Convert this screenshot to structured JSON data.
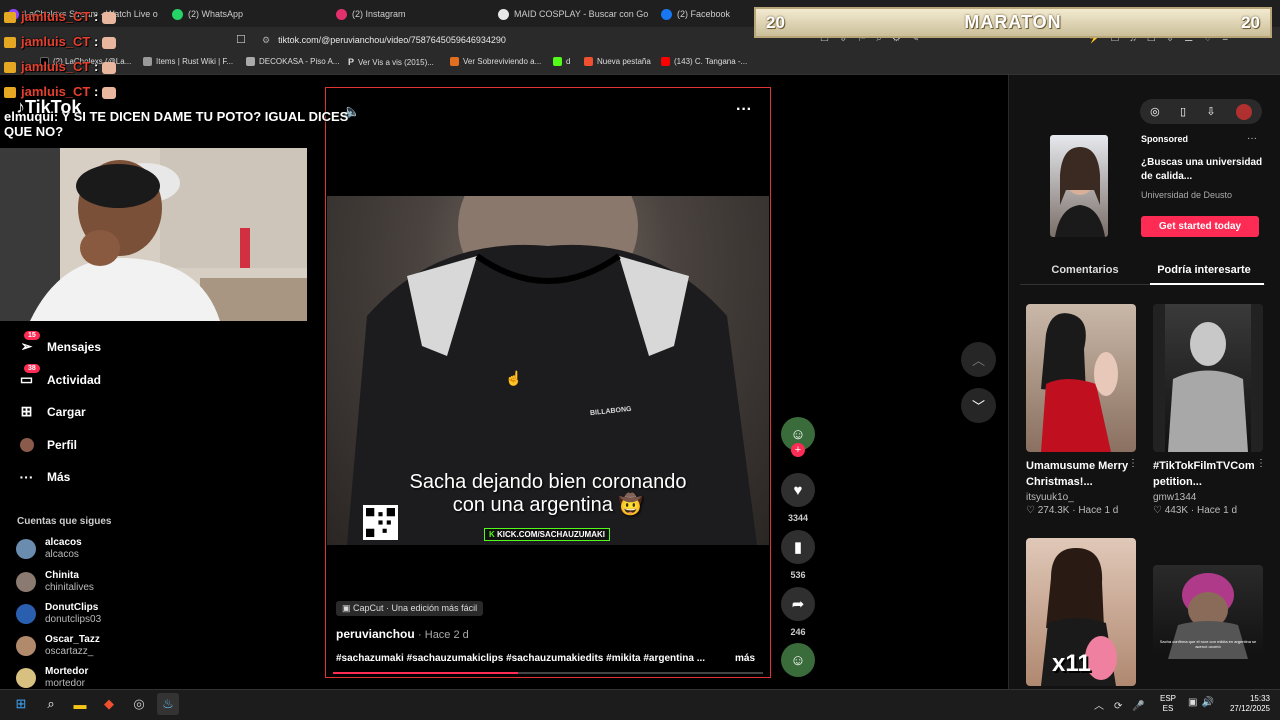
{
  "browser": {
    "tabs": [
      {
        "label": "LaCholexs Stream - Watch Live o",
        "color": "#9146ff"
      },
      {
        "label": "(2) WhatsApp",
        "color": "#25d366"
      },
      {
        "label": "(2) Instagram",
        "color": "#e1306c"
      },
      {
        "label": "MAID COSPLAY - Buscar con Google",
        "color": "#e8e8e8"
      },
      {
        "label": "(2) Facebook",
        "color": "#1877f2"
      }
    ],
    "url": "tiktok.com/@peruvianchou/video/7587645059646934290",
    "bookmarks": [
      {
        "label": "(2) LaCholexs (@La...",
        "color": "#000000"
      },
      {
        "label": "Items | Rust Wiki | F...",
        "color": "#999999"
      },
      {
        "label": "DECOKASA - Piso A...",
        "color": "#aaaaaa"
      },
      {
        "label": "Ver Vis a vis (2015)...",
        "color": "#ffffff"
      },
      {
        "label": "Ver Sobreviviendo a...",
        "color": "#e07020"
      },
      {
        "label": "d",
        "color": "#53fc18"
      },
      {
        "label": "Nueva pestaña",
        "color": "#f05030"
      },
      {
        "label": "(143) C. Tangana -...",
        "color": "#ff0000"
      }
    ]
  },
  "overlay": {
    "maraton": {
      "left": "20",
      "title": "MARATON",
      "right": "20"
    },
    "chat": [
      {
        "user": "jamluis_CT",
        "sep": ":"
      },
      {
        "user": "jamluis_CT",
        "sep": ":"
      },
      {
        "user": "jamluis_CT",
        "sep": ":"
      },
      {
        "user": "jamluis_CT",
        "sep": ":"
      }
    ],
    "chat_message": {
      "user": "elmuqui",
      "text": ": Y SI TE DICEN DAME TU POTO? IGUAL DICES",
      "text2": "QUE NO?"
    }
  },
  "tiktok": {
    "logo": "TikTok",
    "nav": [
      {
        "label": "Mensajes",
        "badge": "15",
        "icon": "send-icon"
      },
      {
        "label": "Actividad",
        "badge": "38",
        "icon": "inbox-icon"
      },
      {
        "label": "Cargar",
        "badge": "",
        "icon": "upload-icon"
      },
      {
        "label": "Perfil",
        "badge": "",
        "icon": "profile-icon"
      },
      {
        "label": "Más",
        "badge": "",
        "icon": "more-icon"
      }
    ],
    "following_title": "Cuentas que sigues",
    "following": [
      {
        "name": "alcacos",
        "handle": "alcacos",
        "color": "#6a8caf"
      },
      {
        "name": "Chinita",
        "handle": "chinitalives",
        "color": "#8a7a70"
      },
      {
        "name": "DonutClips",
        "handle": "donutclips03",
        "color": "#2a5fb0"
      },
      {
        "name": "Oscar_Tazz",
        "handle": "oscartazz_",
        "color": "#b08a6a"
      },
      {
        "name": "Mortedor",
        "handle": "mortedor",
        "color": "#d8c080"
      }
    ],
    "video": {
      "caption_line1": "Sacha dejando bien coronando",
      "caption_line2": "con una argentina 🤠",
      "kick_label": "KICK.COM/SACHAUZUMAKI",
      "shirt_brand": "BILLABONG",
      "capcut": "CapCut · Una edición más fácil",
      "author": "peruvianchou",
      "age": "· Hace 2 d",
      "hashtags": "#sachazumaki #sachauzumakiclips #sachauzumakiedits #mikita #argentina ...",
      "more": "más",
      "progress": 0.43
    },
    "actions": {
      "likes": "3344",
      "saves": "536",
      "shares": "246"
    },
    "ad": {
      "sponsored": "Sponsored",
      "title": "¿Buscas una universidad de calida...",
      "advertiser": "Universidad de Deusto",
      "cta": "Get started today"
    },
    "tabs": [
      {
        "label": "Comentarios",
        "active": false
      },
      {
        "label": "Podría interesarte",
        "active": true
      }
    ],
    "recommended": [
      {
        "title": "Umamusume Merry Christmas!...",
        "author": "itsyuuk1o_",
        "meta": "♡ 274.3K · Hace 1 d"
      },
      {
        "title": "#TikTokFilmTVCom petition...",
        "author": "gmw1344",
        "meta": "♡ 443K · Hace 1 d"
      },
      {
        "title": "",
        "author": "",
        "meta": "",
        "overlay": "x11"
      },
      {
        "title": "",
        "author": "",
        "meta": "",
        "overlay": "Sacha confirma que el roce con mikita en argentina se acercó ocurrió"
      }
    ]
  },
  "taskbar": {
    "lang1": "ESP",
    "lang2": "ES",
    "time": "15:33",
    "date": "27/12/2025"
  }
}
